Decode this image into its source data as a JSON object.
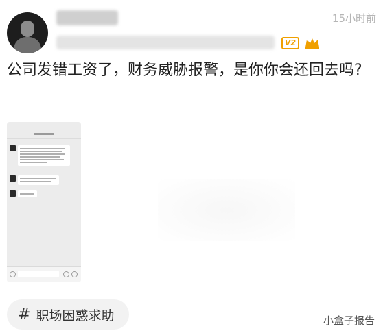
{
  "post": {
    "timestamp": "15小时前",
    "level_badge": "V2",
    "text": "公司发错工资了，财务威胁报警，是你你会还回去吗?",
    "topic_tag": "职场困惑求助",
    "topic_icon": "hash-icon"
  },
  "watermark": {
    "text": "小盒子报告"
  },
  "colors": {
    "badge": "#f0a000",
    "crown": "#f0a000",
    "timestamp": "#b5b5b5"
  },
  "icons": [
    "avatar",
    "level-badge",
    "crown-icon",
    "hash-icon"
  ]
}
